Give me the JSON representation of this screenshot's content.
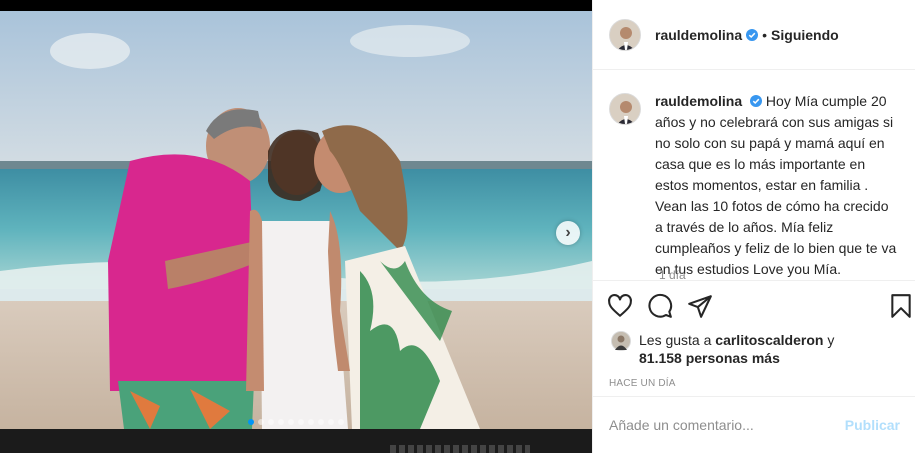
{
  "post": {
    "username": "rauldemolina",
    "follow_status": "Siguiendo",
    "separator": "•",
    "caption_text": "Hoy Mía cumple 20 años y no celebrará con sus amigas si no solo con su papá y mamá aquí en casa que es lo más importante en estos momentos, estar en familia . Vean las 10 fotos de cómo ha crecido a través de lo años. Mía feliz cumpleaños y feliz de lo bien que te va en tus estudios Love you Mía.",
    "caption_time": "1 día",
    "likes_prefix": "Les gusta a",
    "liker": "carlitoscalderon",
    "likes_and": "y",
    "likes_count": "81.158 personas más",
    "timestamp": "HACE UN DÍA",
    "comment_placeholder": "Añade un comentario...",
    "publish_label": "Publicar"
  },
  "carousel": {
    "total": 10,
    "active_index": 0,
    "next_label": "›"
  },
  "icons": {
    "like": "heart-icon",
    "comment": "comment-icon",
    "share": "share-icon",
    "save": "bookmark-icon",
    "verified": "verified-badge-icon"
  },
  "colors": {
    "accent_blue": "#0095f6",
    "publish_disabled": "#b2dffc",
    "verified": "#3897f0",
    "border": "#efefef",
    "muted": "#8e8e8e"
  }
}
